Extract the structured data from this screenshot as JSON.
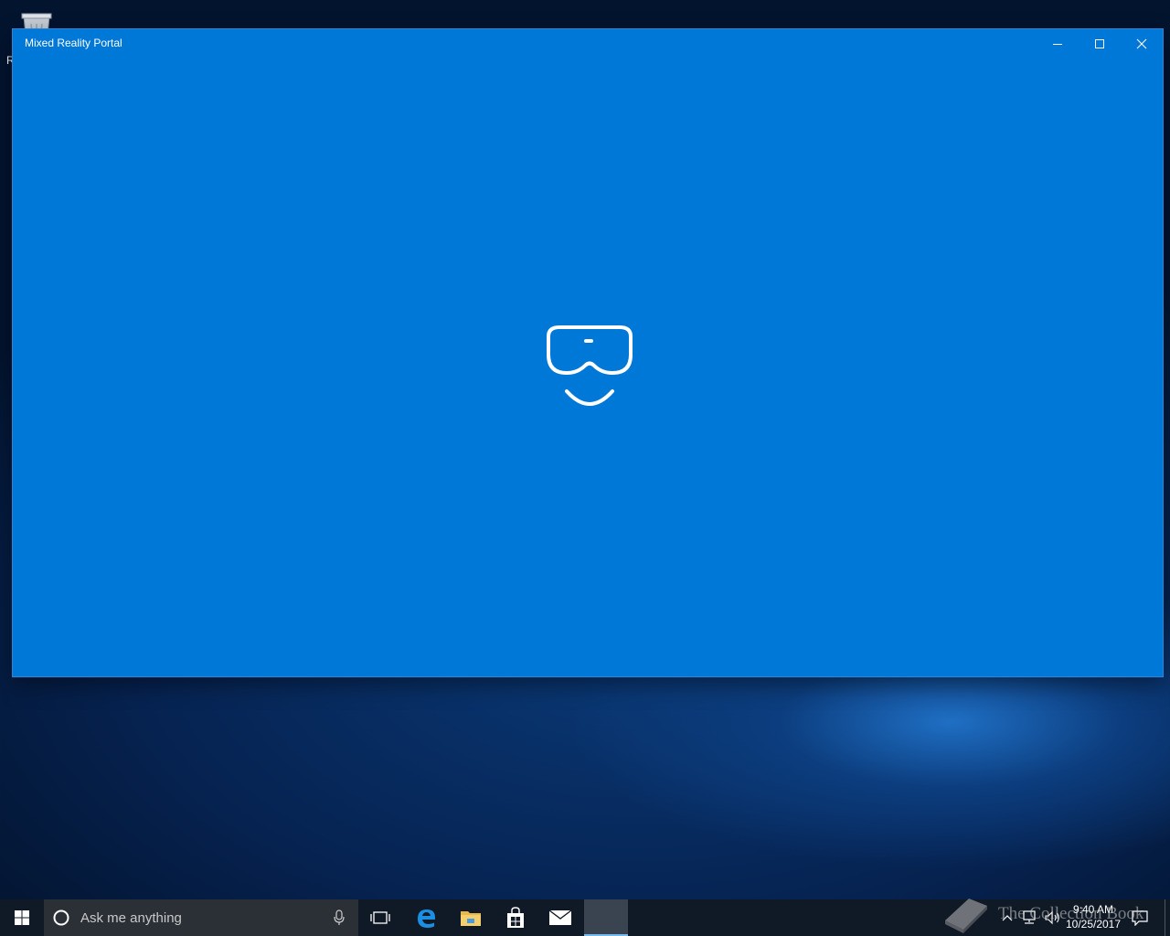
{
  "desktop": {
    "recycle_bin_label": "R"
  },
  "window": {
    "title": "Mixed Reality Portal",
    "background_color": "#0078d7",
    "minimize_icon": "minimize-icon",
    "maximize_icon": "maximize-icon",
    "close_icon": "close-icon",
    "splash_icon": "mixed-reality-headset-icon"
  },
  "taskbar": {
    "search_placeholder": "Ask me anything",
    "pinned_apps": [
      "task-view",
      "microsoft-edge",
      "file-explorer",
      "microsoft-store",
      "mail",
      "mixed-reality-portal"
    ],
    "time": "9:40 AM",
    "date": "10/25/2017"
  },
  "watermark": {
    "text": "The Collection Book"
  }
}
